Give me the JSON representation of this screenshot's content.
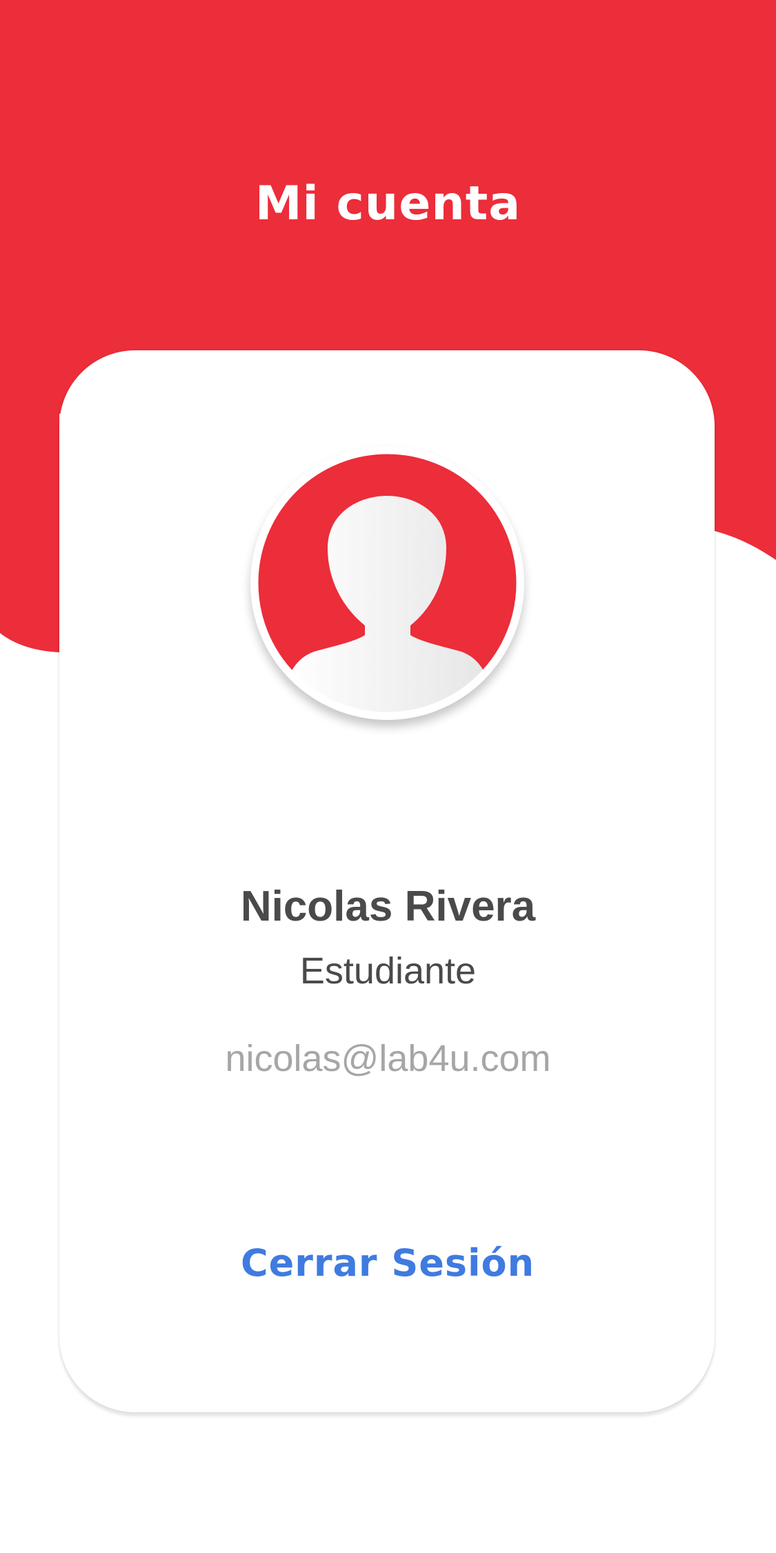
{
  "colors": {
    "brand_red": "#EC2D3A",
    "text_dark": "#4A4A4A",
    "text_muted": "#A6A6A6",
    "link_blue": "#3F7BE0",
    "card_bg": "#FFFFFF"
  },
  "header": {
    "title": "Mi cuenta"
  },
  "profile": {
    "avatar_icon": "user-silhouette-icon",
    "name": "Nicolas Rivera",
    "role": "Estudiante",
    "email": "nicolas@lab4u.com"
  },
  "actions": {
    "logout_label": "Cerrar Sesión"
  }
}
